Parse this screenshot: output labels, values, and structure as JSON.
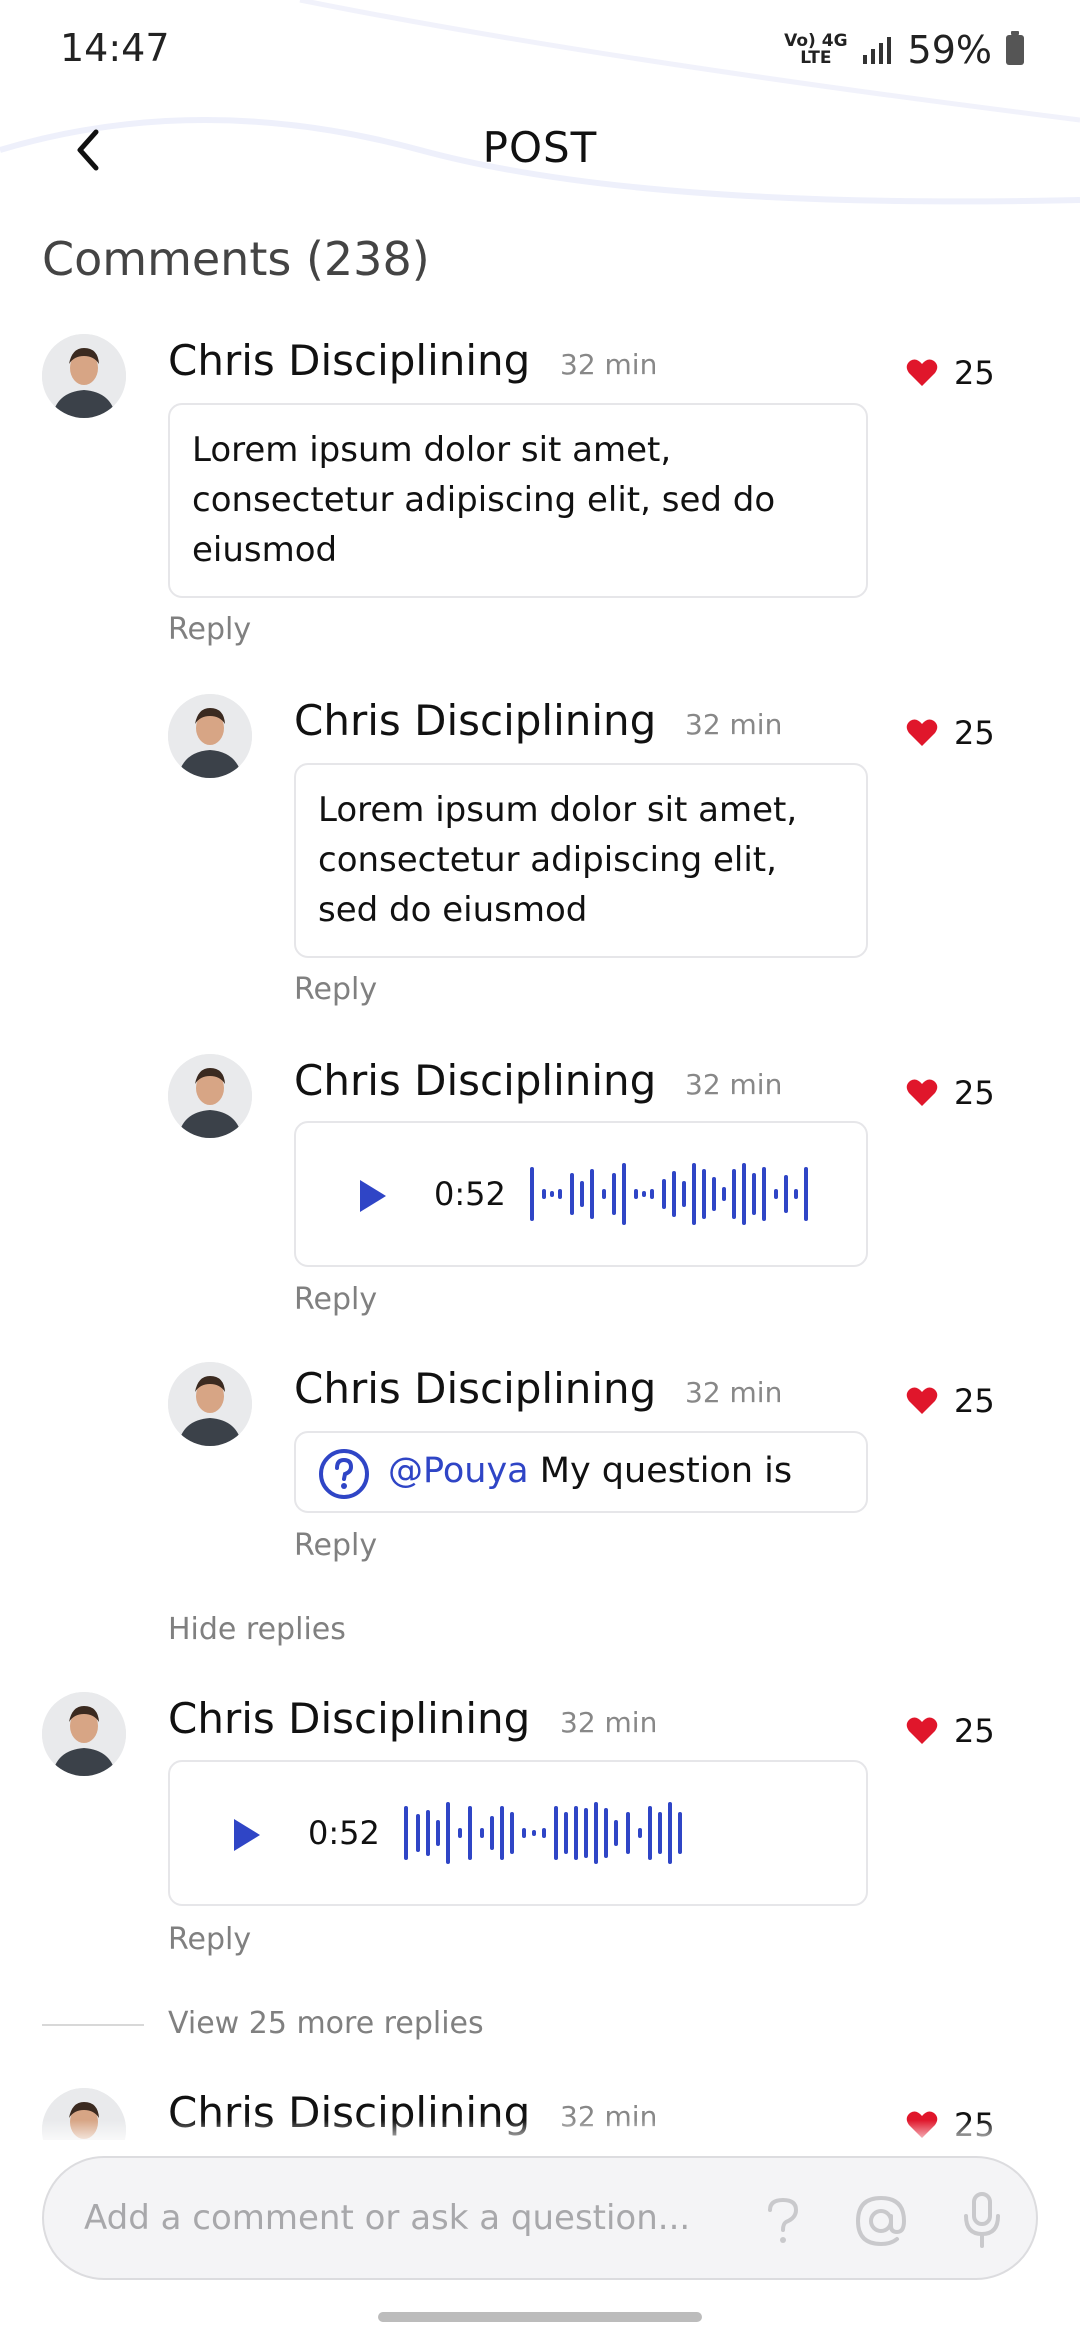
{
  "status_bar": {
    "time": "14:47",
    "network_top": "Vo) 4G",
    "network_bottom": "LTE",
    "battery": "59%"
  },
  "header": {
    "title": "POST",
    "back_icon": "chevron-left-icon"
  },
  "comments_title": "Comments (238)",
  "colors": {
    "accent": "#2f45c6",
    "heart": "#e0162b",
    "muted": "#808080"
  },
  "comments": [
    {
      "name": "Chris Disciplining",
      "time": "32 min",
      "likes": "25",
      "type": "text",
      "text": "Lorem ipsum dolor sit amet, consectetur adipiscing elit, sed do eiusmod",
      "reply": "Reply"
    },
    {
      "name": "Chris Disciplining",
      "time": "32 min",
      "likes": "25",
      "type": "text",
      "text": "Lorem ipsum dolor sit amet, consectetur adipiscing elit, sed do eiusmod",
      "reply": "Reply"
    },
    {
      "name": "Chris Disciplining",
      "time": "32 min",
      "likes": "25",
      "type": "voice",
      "duration": "0:52",
      "reply": "Reply"
    },
    {
      "name": "Chris Disciplining",
      "time": "32 min",
      "likes": "25",
      "type": "question",
      "mention": "@Pouya",
      "text": "My question is",
      "reply": "Reply"
    },
    {
      "name": "Chris Disciplining",
      "time": "32 min",
      "likes": "25",
      "type": "voice",
      "duration": "0:52",
      "reply": "Reply"
    },
    {
      "name": "Chris Disciplining",
      "time": "32 min",
      "likes": "25"
    }
  ],
  "hide_replies": "Hide replies",
  "view_more_replies": "View 25 more replies",
  "comment_input": {
    "placeholder": "Add a comment or ask a question...",
    "icons": [
      "question-icon",
      "at-icon",
      "microphone-icon"
    ]
  }
}
